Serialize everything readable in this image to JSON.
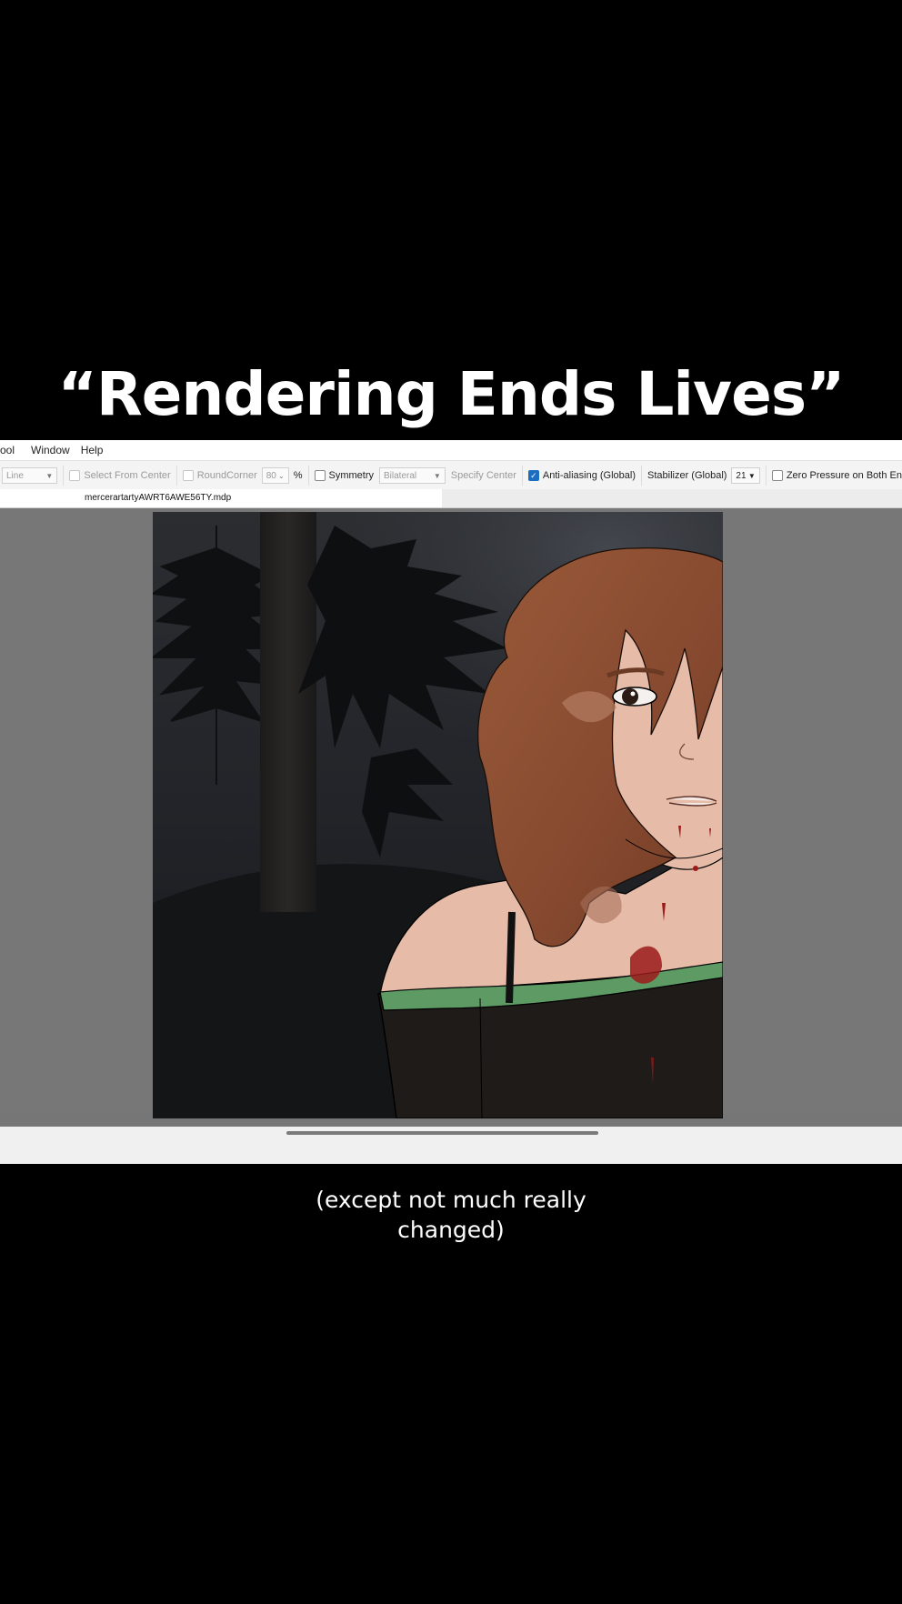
{
  "overlay": {
    "title": "“Rendering Ends Lives”",
    "subtitle_line1": "(except not much really",
    "subtitle_line2": "changed)"
  },
  "menubar": {
    "items": [
      "ool",
      "Window",
      "Help"
    ]
  },
  "toolbar": {
    "shape_select": "Line",
    "select_from_center": {
      "label": "Select From Center",
      "checked": false
    },
    "round_corner": {
      "label": "RoundCorner",
      "value": "80",
      "unit": "%",
      "checked": false
    },
    "symmetry": {
      "label": "Symmetry",
      "checked": false,
      "mode": "Bilateral"
    },
    "specify_center_label": "Specify Center",
    "anti_aliasing": {
      "label": "Anti-aliasing (Global)",
      "checked": true
    },
    "stabilizer": {
      "label": "Stabilizer (Global)",
      "value": "21"
    },
    "zero_pressure": {
      "label": "Zero Pressure on Both En",
      "checked": false
    }
  },
  "document": {
    "tab_name": "mercerartartyAWRT6AWE56TY.mdp"
  },
  "colors": {
    "hair": "#8a4e33",
    "skin": "#e6bba7",
    "collar": "#5e9a64",
    "shirt": "#1f1b19",
    "blood": "#9b1b1b",
    "checkbox_on": "#1b6ec2"
  }
}
